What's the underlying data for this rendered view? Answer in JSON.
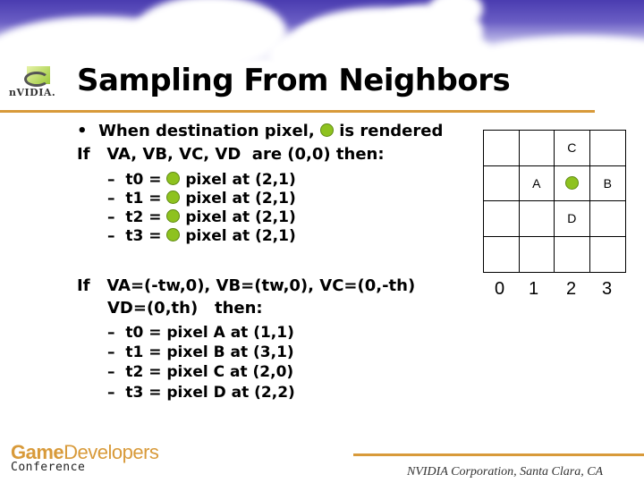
{
  "header": {
    "title": "Sampling From Neighbors",
    "logo_text": "nVIDIA."
  },
  "colors": {
    "accent_rule": "#d89a3a",
    "dot_green": "#8ec21f",
    "sky_blue": "#4a3cb0"
  },
  "section1": {
    "bullet": "•",
    "line1_prefix": "When destination pixel,",
    "line1_suffix": "is rendered",
    "line2": "If   VA, VB, VC, VD  are (0,0) then:",
    "items": [
      {
        "dash": "–",
        "lhs": "t0 =",
        "rhs": "pixel at (2,1)"
      },
      {
        "dash": "–",
        "lhs": "t1 =",
        "rhs": "pixel at (2,1)"
      },
      {
        "dash": "–",
        "lhs": "t2 =",
        "rhs": "pixel at (2,1)"
      },
      {
        "dash": "–",
        "lhs": "t3 =",
        "rhs": "pixel at (2,1)"
      }
    ]
  },
  "section2": {
    "line1": "If   VA=(-tw,0), VB=(tw,0), VC=(0,-th)",
    "line2": "VD=(0,th)   then:",
    "items": [
      {
        "dash": "–",
        "text": "t0 = pixel A at (1,1)"
      },
      {
        "dash": "–",
        "text": "t1 = pixel B at (3,1)"
      },
      {
        "dash": "–",
        "text": "t2 = pixel C at (2,0)"
      },
      {
        "dash": "–",
        "text": "t3 = pixel D at (2,2)"
      }
    ]
  },
  "grid": {
    "cells": [
      "",
      "",
      "C",
      "",
      "",
      "A",
      "*",
      "B",
      "",
      "",
      "D",
      "",
      "",
      "",
      "",
      ""
    ],
    "x_labels": [
      "0",
      "1",
      "2",
      "3"
    ]
  },
  "footer": {
    "gdc_bold": "Game",
    "gdc_light": "Developers",
    "gdc_sub": "Conference",
    "credit": "NVIDIA Corporation, Santa Clara, CA"
  }
}
